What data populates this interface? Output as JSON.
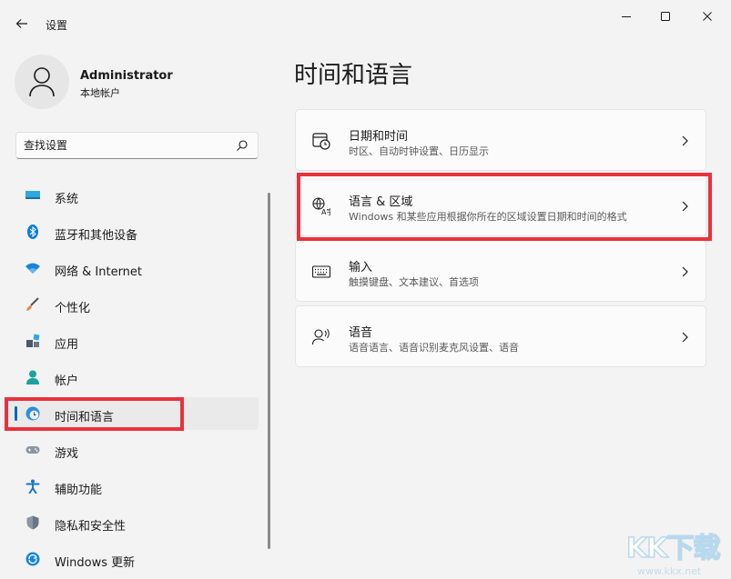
{
  "window": {
    "title": "设置"
  },
  "profile": {
    "name": "Administrator",
    "account_type": "本地帐户"
  },
  "search": {
    "placeholder": "查找设置"
  },
  "nav": {
    "items": [
      {
        "label": "系统",
        "icon": "monitor-icon"
      },
      {
        "label": "蓝牙和其他设备",
        "icon": "bluetooth-icon"
      },
      {
        "label": "网络 & Internet",
        "icon": "wifi-icon"
      },
      {
        "label": "个性化",
        "icon": "paintbrush-icon"
      },
      {
        "label": "应用",
        "icon": "apps-icon"
      },
      {
        "label": "帐户",
        "icon": "person-icon"
      },
      {
        "label": "时间和语言",
        "icon": "globe-clock-icon",
        "active": true
      },
      {
        "label": "游戏",
        "icon": "gamepad-icon"
      },
      {
        "label": "辅助功能",
        "icon": "accessibility-icon"
      },
      {
        "label": "隐私和安全性",
        "icon": "shield-icon"
      },
      {
        "label": "Windows 更新",
        "icon": "update-icon"
      }
    ]
  },
  "main": {
    "title": "时间和语言",
    "cards": [
      {
        "title": "日期和时间",
        "desc": "时区、自动时钟设置、日历显示",
        "icon": "calendar-clock-icon"
      },
      {
        "title": "语言 & 区域",
        "desc": "Windows 和某些应用根据你所在的区域设置日期和时间的格式",
        "icon": "language-icon"
      },
      {
        "title": "输入",
        "desc": "触摸键盘、文本建议、首选项",
        "icon": "keyboard-icon"
      },
      {
        "title": "语音",
        "desc": "语音语言、语音识别麦克风设置、语音",
        "icon": "speech-icon"
      }
    ]
  },
  "watermark": {
    "logo": "KK下载",
    "url": "www.kkx.net"
  },
  "colors": {
    "accent": "#0067c0",
    "highlight_box": "#e8323c",
    "background": "#f3f3f3",
    "card": "#fbfbfb"
  }
}
